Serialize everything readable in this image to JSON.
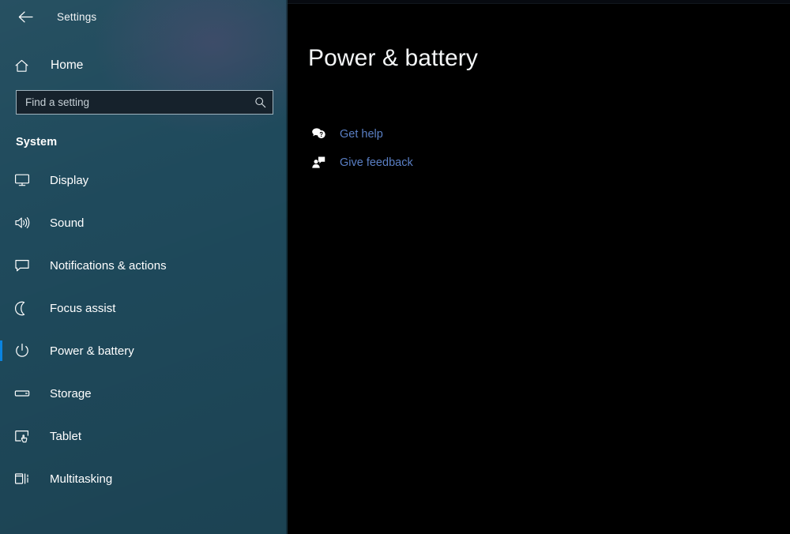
{
  "window": {
    "app_title": "Settings",
    "back_icon": "back-arrow-icon"
  },
  "sidebar": {
    "background_color": "#1f4a5c",
    "accent_color": "#0a84e0",
    "home": {
      "label": "Home",
      "icon": "home-icon"
    },
    "search": {
      "placeholder": "Find a setting",
      "value": "",
      "icon": "search-icon"
    },
    "section_header": "System",
    "items": [
      {
        "label": "Display",
        "icon": "monitor-icon",
        "selected": false
      },
      {
        "label": "Sound",
        "icon": "speaker-icon",
        "selected": false
      },
      {
        "label": "Notifications & actions",
        "icon": "notification-bubble-icon",
        "selected": false
      },
      {
        "label": "Focus assist",
        "icon": "moon-icon",
        "selected": false
      },
      {
        "label": "Power & battery",
        "icon": "power-icon",
        "selected": true
      },
      {
        "label": "Storage",
        "icon": "drive-icon",
        "selected": false
      },
      {
        "label": "Tablet",
        "icon": "tablet-touch-icon",
        "selected": false
      },
      {
        "label": "Multitasking",
        "icon": "multitasking-panes-icon",
        "selected": false
      }
    ]
  },
  "main": {
    "title": "Power & battery",
    "subtitle": "",
    "links": [
      {
        "label": "Get help",
        "icon": "help-bubble-icon",
        "color": "#5a7fc4"
      },
      {
        "label": "Give feedback",
        "icon": "feedback-person-icon",
        "color": "#5a7fc4"
      }
    ]
  }
}
